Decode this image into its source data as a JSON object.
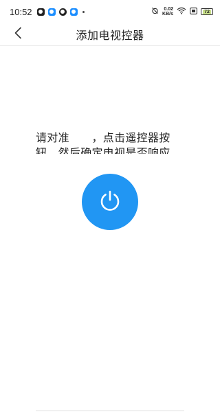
{
  "status_bar": {
    "time": "10:52",
    "net_speed_value": "0.02",
    "net_speed_unit": "KB/s",
    "battery": "72"
  },
  "header": {
    "title": "添加电视控器"
  },
  "main": {
    "instruction": "请对准　　，点击遥控器按钮，然后确定电视是否响应"
  },
  "icons": {
    "back": "chevron-left-icon",
    "power": "power-icon"
  },
  "colors": {
    "accent": "#2196f3"
  }
}
